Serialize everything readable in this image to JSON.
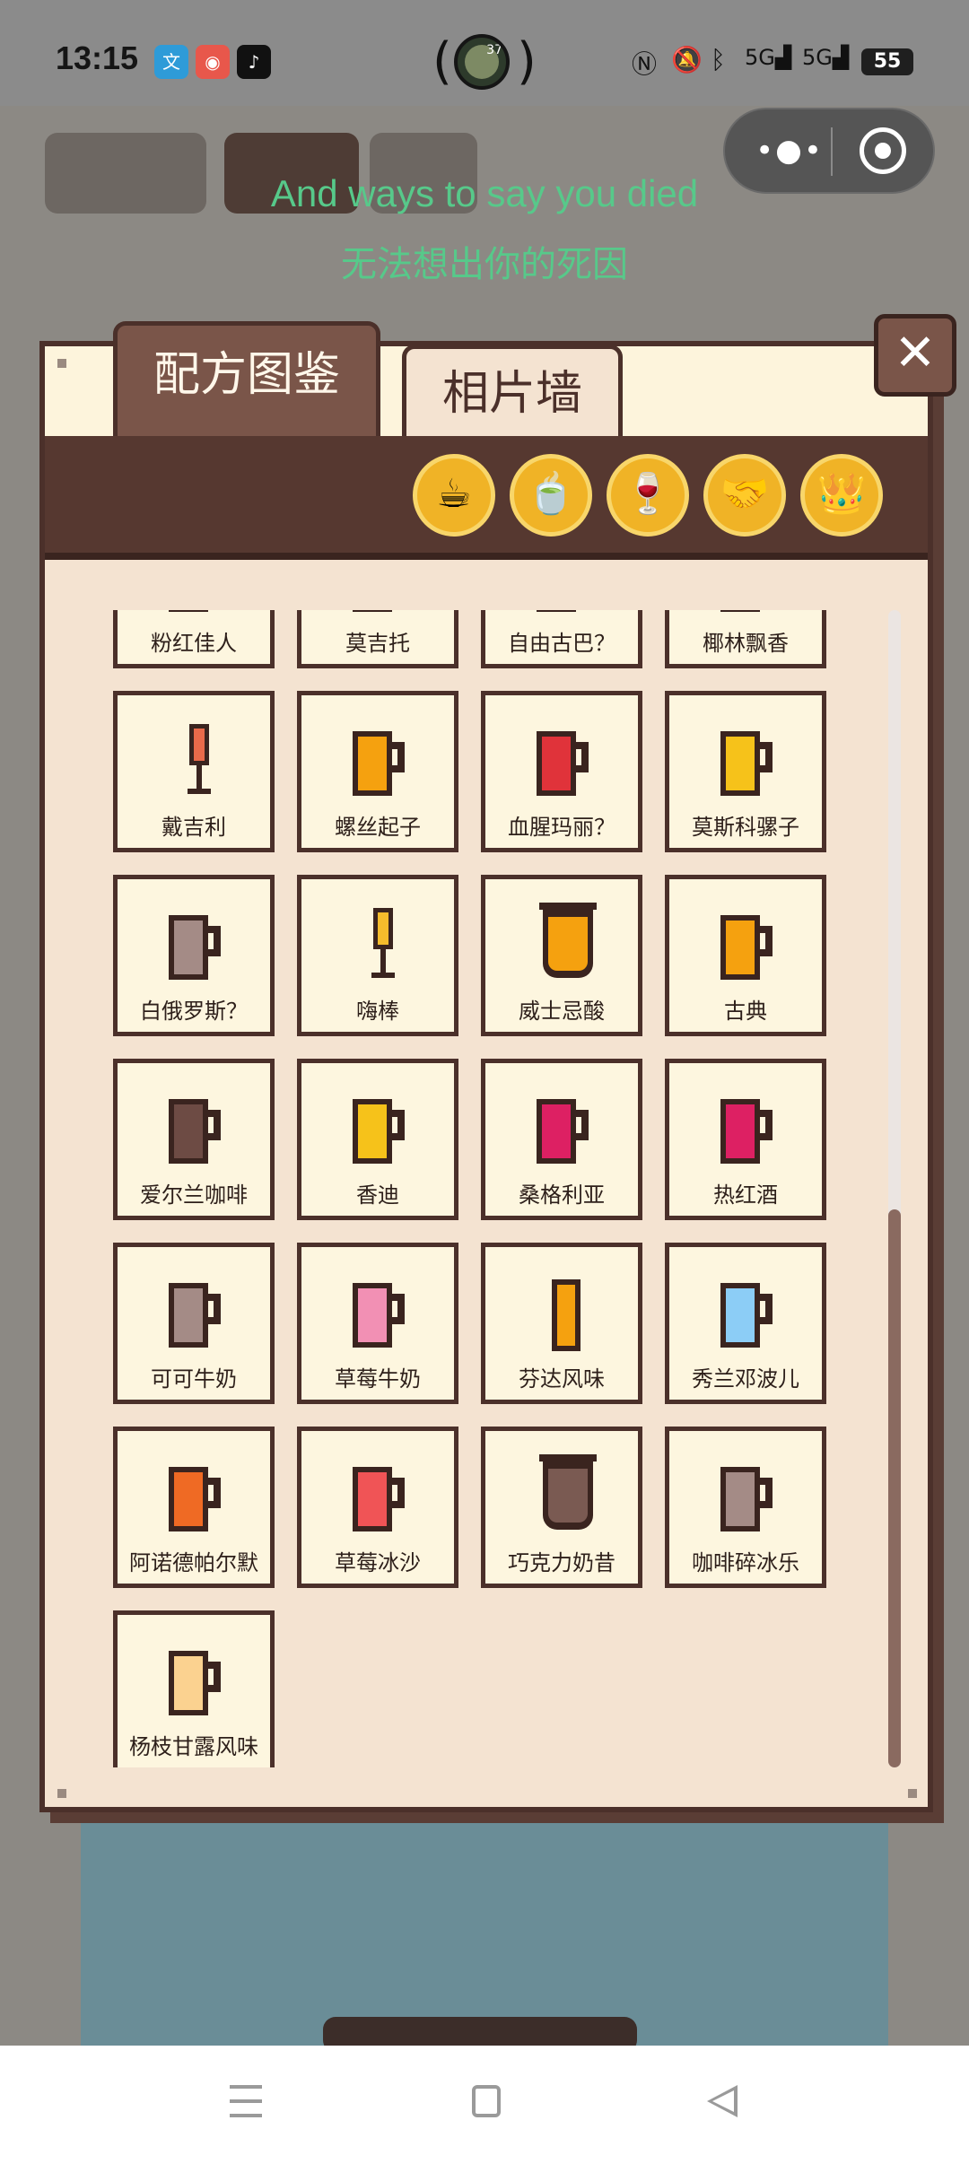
{
  "status_bar": {
    "time": "13:15",
    "apps": [
      {
        "icon": "wen-app-icon",
        "glyph": "文",
        "color": "#2e9bd8"
      },
      {
        "icon": "weibo-icon",
        "glyph": "◉",
        "color": "#e8574b"
      },
      {
        "icon": "tiktok-icon",
        "glyph": "♪",
        "color": "#111111"
      }
    ],
    "avatar_badge": "37",
    "right_icons": [
      "nfc-icon",
      "mute-icon",
      "bluetooth-icon",
      "5g-signal-icon",
      "5g-signal-icon"
    ],
    "battery": "55"
  },
  "subtitles": {
    "english": "And ways to say you died",
    "chinese": "无法想出你的死因"
  },
  "modal": {
    "tabs": [
      {
        "label": "配方图鉴",
        "active": true
      },
      {
        "label": "相片墙",
        "active": false
      }
    ],
    "close_label": "✕",
    "categories": [
      {
        "icon": "coffee-icon",
        "glyph": "☕"
      },
      {
        "icon": "tea-icon",
        "glyph": "🍵"
      },
      {
        "icon": "wine-icon",
        "glyph": "🍷"
      },
      {
        "icon": "handshake-icon",
        "glyph": "🤝"
      },
      {
        "icon": "crown-icon",
        "glyph": "👑"
      }
    ],
    "recipes": [
      {
        "name": "粉红佳人",
        "shape": "cup",
        "color": "#f29bb9"
      },
      {
        "name": "莫吉托",
        "shape": "cup",
        "color": "#9bd36a"
      },
      {
        "name": "自由古巴？",
        "shape": "cup",
        "color": "#8a5a3a"
      },
      {
        "name": "椰林飘香",
        "shape": "cup",
        "color": "#f6ecd0"
      },
      {
        "name": "戴吉利",
        "shape": "stick",
        "color": "#e96a4a"
      },
      {
        "name": "螺丝起子",
        "shape": "cup",
        "color": "#f5a10f"
      },
      {
        "name": "血腥玛丽？",
        "shape": "cup",
        "color": "#e0333a"
      },
      {
        "name": "莫斯科骡子",
        "shape": "cup",
        "color": "#f6c21a"
      },
      {
        "name": "白俄罗斯？",
        "shape": "cup",
        "color": "#a48b86"
      },
      {
        "name": "嗨棒",
        "shape": "stick",
        "color": "#f5bc2c"
      },
      {
        "name": "威士忌酸",
        "shape": "glass",
        "color": "#f5a10f"
      },
      {
        "name": "古典",
        "shape": "cup",
        "color": "#f5a10f"
      },
      {
        "name": "爱尔兰咖啡",
        "shape": "cup",
        "color": "#6d4b44"
      },
      {
        "name": "香迪",
        "shape": "cup",
        "color": "#f6c21a"
      },
      {
        "name": "桑格利亚",
        "shape": "cup",
        "color": "#dd2063"
      },
      {
        "name": "热红酒",
        "shape": "cup",
        "color": "#dd2063"
      },
      {
        "name": "可可牛奶",
        "shape": "cup",
        "color": "#a48b86"
      },
      {
        "name": "草莓牛奶",
        "shape": "cup",
        "color": "#f290b4"
      },
      {
        "name": "芬达风味",
        "shape": "tall",
        "color": "#f5a10f"
      },
      {
        "name": "秀兰邓波儿",
        "shape": "cup",
        "color": "#8ccdf6"
      },
      {
        "name": "阿诺德帕尔默",
        "shape": "cup",
        "color": "#ef6a24"
      },
      {
        "name": "草莓冰沙",
        "shape": "cup",
        "color": "#f05456"
      },
      {
        "name": "巧克力奶昔",
        "shape": "glass",
        "color": "#7a5a52"
      },
      {
        "name": "咖啡碎冰乐",
        "shape": "cup",
        "color": "#a48b86"
      },
      {
        "name": "杨枝甘露风味",
        "shape": "cup",
        "color": "#fbd290"
      }
    ]
  },
  "nav_bar": {
    "icons": [
      "menu-icon",
      "home-icon",
      "back-icon"
    ]
  }
}
